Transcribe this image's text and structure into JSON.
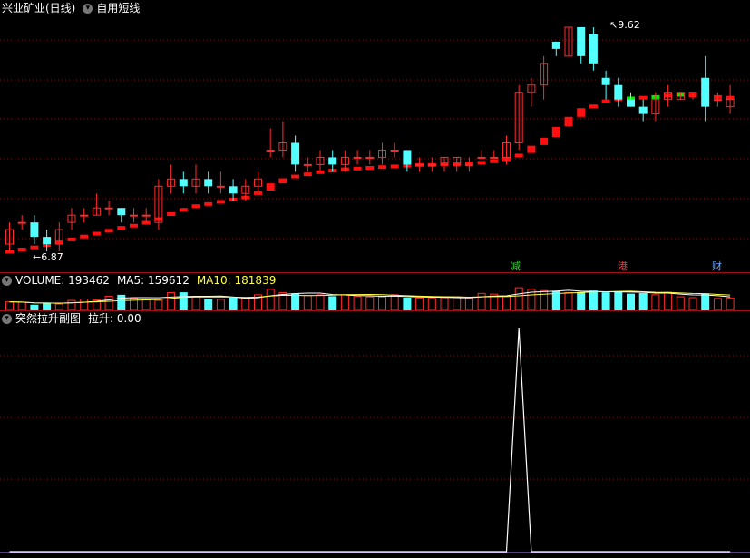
{
  "main": {
    "stock_title": "兴业矿业(日线)",
    "formula_name": "自用短线",
    "high_label": "9.62",
    "low_label": "6.87",
    "markers": [
      {
        "text": "减",
        "color": "#22dd22"
      },
      {
        "text": "港",
        "color": "#ff3333"
      },
      {
        "text": "财",
        "color": "#6aa8ff"
      }
    ],
    "candles": [
      [
        6.6,
        6.8,
        6.5,
        6.9
      ],
      [
        6.9,
        6.9,
        6.8,
        7.0
      ],
      [
        6.9,
        6.7,
        6.6,
        7.0
      ],
      [
        6.7,
        6.6,
        6.5,
        6.8
      ],
      [
        6.6,
        6.8,
        6.5,
        6.9
      ],
      [
        6.9,
        7.0,
        6.8,
        7.1
      ],
      [
        7.0,
        7.0,
        6.9,
        7.1
      ],
      [
        7.0,
        7.1,
        7.0,
        7.3
      ],
      [
        7.1,
        7.1,
        7.0,
        7.2
      ],
      [
        7.1,
        7.0,
        6.9,
        7.1
      ],
      [
        7.0,
        7.0,
        6.9,
        7.1
      ],
      [
        7.0,
        7.0,
        6.9,
        7.1
      ],
      [
        6.9,
        7.4,
        6.8,
        7.5
      ],
      [
        7.4,
        7.5,
        7.3,
        7.7
      ],
      [
        7.5,
        7.4,
        7.3,
        7.6
      ],
      [
        7.4,
        7.5,
        7.3,
        7.7
      ],
      [
        7.5,
        7.4,
        7.3,
        7.6
      ],
      [
        7.4,
        7.4,
        7.3,
        7.6
      ],
      [
        7.4,
        7.3,
        7.2,
        7.5
      ],
      [
        7.3,
        7.4,
        7.2,
        7.5
      ],
      [
        7.4,
        7.5,
        7.3,
        7.6
      ],
      [
        7.9,
        7.9,
        7.8,
        8.2
      ],
      [
        7.9,
        8.0,
        7.8,
        8.3
      ],
      [
        8.0,
        7.7,
        7.6,
        8.1
      ],
      [
        7.7,
        7.7,
        7.6,
        7.8
      ],
      [
        7.7,
        7.8,
        7.6,
        7.9
      ],
      [
        7.8,
        7.7,
        7.6,
        7.9
      ],
      [
        7.7,
        7.8,
        7.6,
        7.9
      ],
      [
        7.8,
        7.8,
        7.7,
        7.9
      ],
      [
        7.8,
        7.8,
        7.7,
        7.9
      ],
      [
        7.8,
        7.9,
        7.7,
        8.0
      ],
      [
        7.9,
        7.9,
        7.8,
        8.0
      ],
      [
        7.9,
        7.7,
        7.6,
        7.9
      ],
      [
        7.7,
        7.7,
        7.6,
        7.8
      ],
      [
        7.7,
        7.7,
        7.6,
        7.8
      ],
      [
        7.7,
        7.8,
        7.6,
        7.8
      ],
      [
        7.7,
        7.8,
        7.6,
        7.8
      ],
      [
        7.7,
        7.7,
        7.6,
        7.8
      ],
      [
        7.8,
        7.8,
        7.8,
        7.9
      ],
      [
        7.8,
        7.8,
        7.8,
        7.9
      ],
      [
        7.8,
        8.0,
        7.7,
        8.1
      ],
      [
        8.0,
        8.7,
        7.9,
        8.8
      ],
      [
        8.7,
        8.8,
        8.5,
        8.9
      ],
      [
        8.8,
        9.1,
        8.6,
        9.2
      ],
      [
        9.4,
        9.3,
        9.2,
        9.4
      ],
      [
        9.2,
        9.6,
        9.2,
        9.6
      ],
      [
        9.6,
        9.2,
        9.1,
        9.6
      ],
      [
        9.5,
        9.1,
        9.0,
        9.6
      ],
      [
        8.9,
        8.8,
        8.6,
        9.0
      ],
      [
        8.8,
        8.6,
        8.5,
        8.9
      ],
      [
        8.6,
        8.5,
        8.5,
        8.7
      ],
      [
        8.5,
        8.4,
        8.3,
        8.6
      ],
      [
        8.4,
        8.6,
        8.3,
        8.7
      ],
      [
        8.6,
        8.7,
        8.5,
        8.8
      ],
      [
        8.6,
        8.7,
        8.6,
        8.7
      ],
      [
        8.7,
        8.7,
        8.6,
        8.7
      ],
      [
        8.9,
        8.5,
        8.3,
        9.2
      ],
      [
        8.6,
        8.6,
        8.5,
        8.7
      ],
      [
        8.5,
        8.6,
        8.4,
        8.8
      ]
    ],
    "signal_bars": [
      [
        6.48,
        6.52
      ],
      [
        6.51,
        6.55
      ],
      [
        6.55,
        6.58
      ],
      [
        6.58,
        6.61
      ],
      [
        6.61,
        6.65
      ],
      [
        6.65,
        6.69
      ],
      [
        6.69,
        6.73
      ],
      [
        6.73,
        6.77
      ],
      [
        6.77,
        6.81
      ],
      [
        6.81,
        6.85
      ],
      [
        6.85,
        6.88
      ],
      [
        6.89,
        6.92
      ],
      [
        6.93,
        6.97
      ],
      [
        6.99,
        7.04
      ],
      [
        7.05,
        7.1
      ],
      [
        7.1,
        7.15
      ],
      [
        7.15,
        7.18
      ],
      [
        7.18,
        7.21
      ],
      [
        7.21,
        7.24
      ],
      [
        7.24,
        7.27
      ],
      [
        7.28,
        7.33
      ],
      [
        7.34,
        7.44
      ],
      [
        7.44,
        7.51
      ],
      [
        7.52,
        7.56
      ],
      [
        7.56,
        7.59
      ],
      [
        7.59,
        7.62
      ],
      [
        7.62,
        7.64
      ],
      [
        7.64,
        7.66
      ],
      [
        7.66,
        7.67
      ],
      [
        7.67,
        7.68
      ],
      [
        7.68,
        7.69
      ],
      [
        7.69,
        7.7
      ],
      [
        7.7,
        7.71
      ],
      [
        7.71,
        7.72
      ],
      [
        7.72,
        7.72
      ],
      [
        7.72,
        7.73
      ],
      [
        7.73,
        7.73
      ],
      [
        7.73,
        7.74
      ],
      [
        7.74,
        7.75
      ],
      [
        7.75,
        7.77
      ],
      [
        7.77,
        7.8
      ],
      [
        7.8,
        7.85
      ],
      [
        7.86,
        7.96
      ],
      [
        7.97,
        8.07
      ],
      [
        8.08,
        8.22
      ],
      [
        8.23,
        8.36
      ],
      [
        8.36,
        8.48
      ],
      [
        8.48,
        8.53
      ],
      [
        8.57,
        8.6
      ],
      [
        8.6,
        8.63
      ],
      [
        8.62,
        8.64
      ],
      [
        8.62,
        8.65
      ],
      [
        8.62,
        8.66
      ],
      [
        8.64,
        8.68
      ],
      [
        8.65,
        8.69
      ],
      [
        8.65,
        8.68
      ],
      [
        8.65,
        8.69
      ],
      [
        8.63,
        8.66
      ],
      [
        8.62,
        8.65
      ]
    ]
  },
  "volume": {
    "label": "VOLUME:",
    "value": "193462",
    "ma5_label": "MA5:",
    "ma5_value": "159612",
    "ma10_label": "MA10:",
    "ma10_value": "181839",
    "bars": [
      60,
      58,
      40,
      52,
      45,
      70,
      80,
      75,
      100,
      110,
      85,
      80,
      70,
      125,
      128,
      95,
      80,
      78,
      90,
      88,
      110,
      150,
      125,
      120,
      105,
      110,
      100,
      110,
      98,
      95,
      95,
      110,
      90,
      88,
      85,
      90,
      95,
      88,
      120,
      115,
      98,
      160,
      150,
      140,
      135,
      125,
      130,
      140,
      128,
      132,
      118,
      122,
      110,
      128,
      96,
      90,
      120,
      84,
      88
    ]
  },
  "indicator": {
    "title": "突然拉升副图",
    "label": "拉升:",
    "value": "0.00",
    "spike_index": 41,
    "spike_value": 1
  },
  "colors": {
    "up": "#ff2a2a",
    "down": "#54ffff",
    "signal": "#ff1010",
    "green_signal": "#00ee00",
    "separator": "#a01010",
    "grid": "#7a1010",
    "ma10": "#ffff44",
    "ma5": "#ffffff"
  }
}
